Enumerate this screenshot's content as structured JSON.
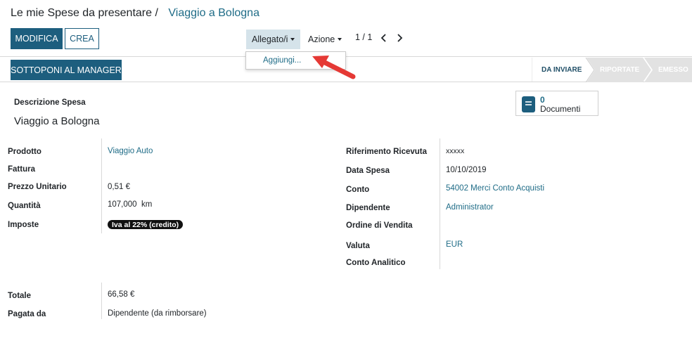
{
  "breadcrumb": {
    "parent": "Le mie Spese da presentare",
    "separator": "/",
    "current": "Viaggio a Bologna"
  },
  "toolbar": {
    "edit_label": "MODIFICA",
    "create_label": "CREA",
    "attachments_label": "Allegato/i",
    "action_label": "Azione",
    "pager": "1 / 1"
  },
  "attachments_menu": {
    "add_label": "Aggiungi..."
  },
  "statusbar": {
    "submit_label": "SOTTOPONI AL MANAGER",
    "steps": [
      {
        "label": "DA INVIARE",
        "active": true
      },
      {
        "label": "RIPORTATE",
        "active": false
      },
      {
        "label": "EMESSO",
        "active": false
      }
    ]
  },
  "documents_button": {
    "count": "0",
    "label": "Documenti"
  },
  "form": {
    "description_label": "Descrizione Spesa",
    "description_value": "Viaggio a Bologna",
    "left_fields": [
      {
        "label": "Prodotto",
        "value": "Viaggio Auto"
      },
      {
        "label": "Fattura",
        "value": ""
      },
      {
        "label": "Prezzo Unitario",
        "value": "0,51 €"
      },
      {
        "label": "Quantità",
        "value": "107,000  km"
      },
      {
        "label": "Imposte",
        "value": "Iva al 22% (credito)"
      }
    ],
    "right_fields": [
      {
        "label": "Riferimento Ricevuta",
        "value": "xxxxx"
      },
      {
        "label": "Data Spesa",
        "value": "10/10/2019"
      },
      {
        "label": "Conto",
        "value": "54002 Merci Conto Acquisti"
      },
      {
        "label": "Dipendente",
        "value": "Administrator"
      },
      {
        "label": "Ordine di Vendita",
        "value": ""
      },
      {
        "label": "Valuta",
        "value": "EUR"
      },
      {
        "label": "Conto Analitico",
        "value": ""
      }
    ],
    "total_fields": [
      {
        "label": "Totale",
        "value": "66,58 €"
      },
      {
        "label": "Pagata da",
        "value": "Dipendente (da rimborsare)"
      }
    ]
  },
  "colors": {
    "primary": "#1d5e7e",
    "link": "#1f6c87",
    "annotation_arrow": "#e53935"
  },
  "icons": {
    "documents": "book-icon",
    "pager_prev": "chevron-left-icon",
    "pager_next": "chevron-right-icon",
    "annotation": "red-arrow-icon"
  }
}
